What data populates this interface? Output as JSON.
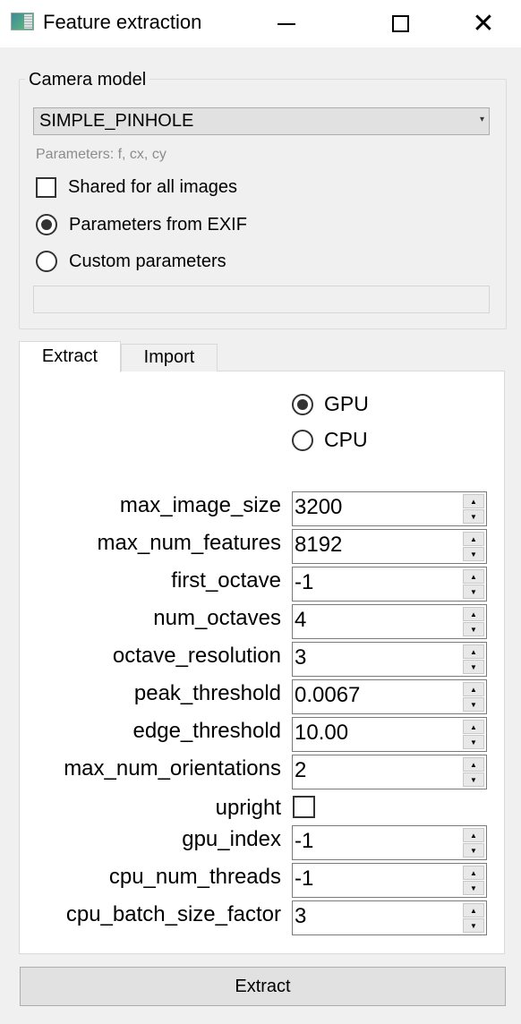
{
  "window": {
    "title": "Feature extraction",
    "app_icon": "app-window-icon",
    "controls": {
      "minimize": "—",
      "maximize": "□",
      "close": "✕"
    }
  },
  "camera_model": {
    "group_title": "Camera model",
    "selected_model": "SIMPLE_PINHOLE",
    "dropdown_arrow": "▾",
    "parameters_hint": "Parameters: f, cx, cy",
    "shared_checkbox": {
      "label": "Shared for all images",
      "checked": false
    },
    "radio_options": [
      {
        "label": "Parameters from EXIF",
        "checked": true
      },
      {
        "label": "Custom parameters",
        "checked": false
      }
    ],
    "custom_params_value": ""
  },
  "tabs": [
    {
      "label": "Extract",
      "active": true
    },
    {
      "label": "Import",
      "active": false
    }
  ],
  "extract": {
    "device_options": [
      {
        "label": "GPU",
        "checked": true
      },
      {
        "label": "CPU",
        "checked": false
      }
    ],
    "params": [
      {
        "label": "max_image_size",
        "value": "3200",
        "type": "spin"
      },
      {
        "label": "max_num_features",
        "value": "8192",
        "type": "spin"
      },
      {
        "label": "first_octave",
        "value": "-1",
        "type": "spin"
      },
      {
        "label": "num_octaves",
        "value": "4",
        "type": "spin"
      },
      {
        "label": "octave_resolution",
        "value": "3",
        "type": "spin"
      },
      {
        "label": "peak_threshold",
        "value": "0.0067",
        "type": "spin"
      },
      {
        "label": "edge_threshold",
        "value": "10.00",
        "type": "spin"
      },
      {
        "label": "max_num_orientations",
        "value": "2",
        "type": "spin"
      },
      {
        "label": "upright",
        "value": false,
        "type": "checkbox"
      },
      {
        "label": "gpu_index",
        "value": "-1",
        "type": "spin"
      },
      {
        "label": "cpu_num_threads",
        "value": "-1",
        "type": "spin"
      },
      {
        "label": "cpu_batch_size_factor",
        "value": "3",
        "type": "spin"
      }
    ],
    "spin_up": "▲",
    "spin_down": "▼"
  },
  "extract_button_label": "Extract"
}
